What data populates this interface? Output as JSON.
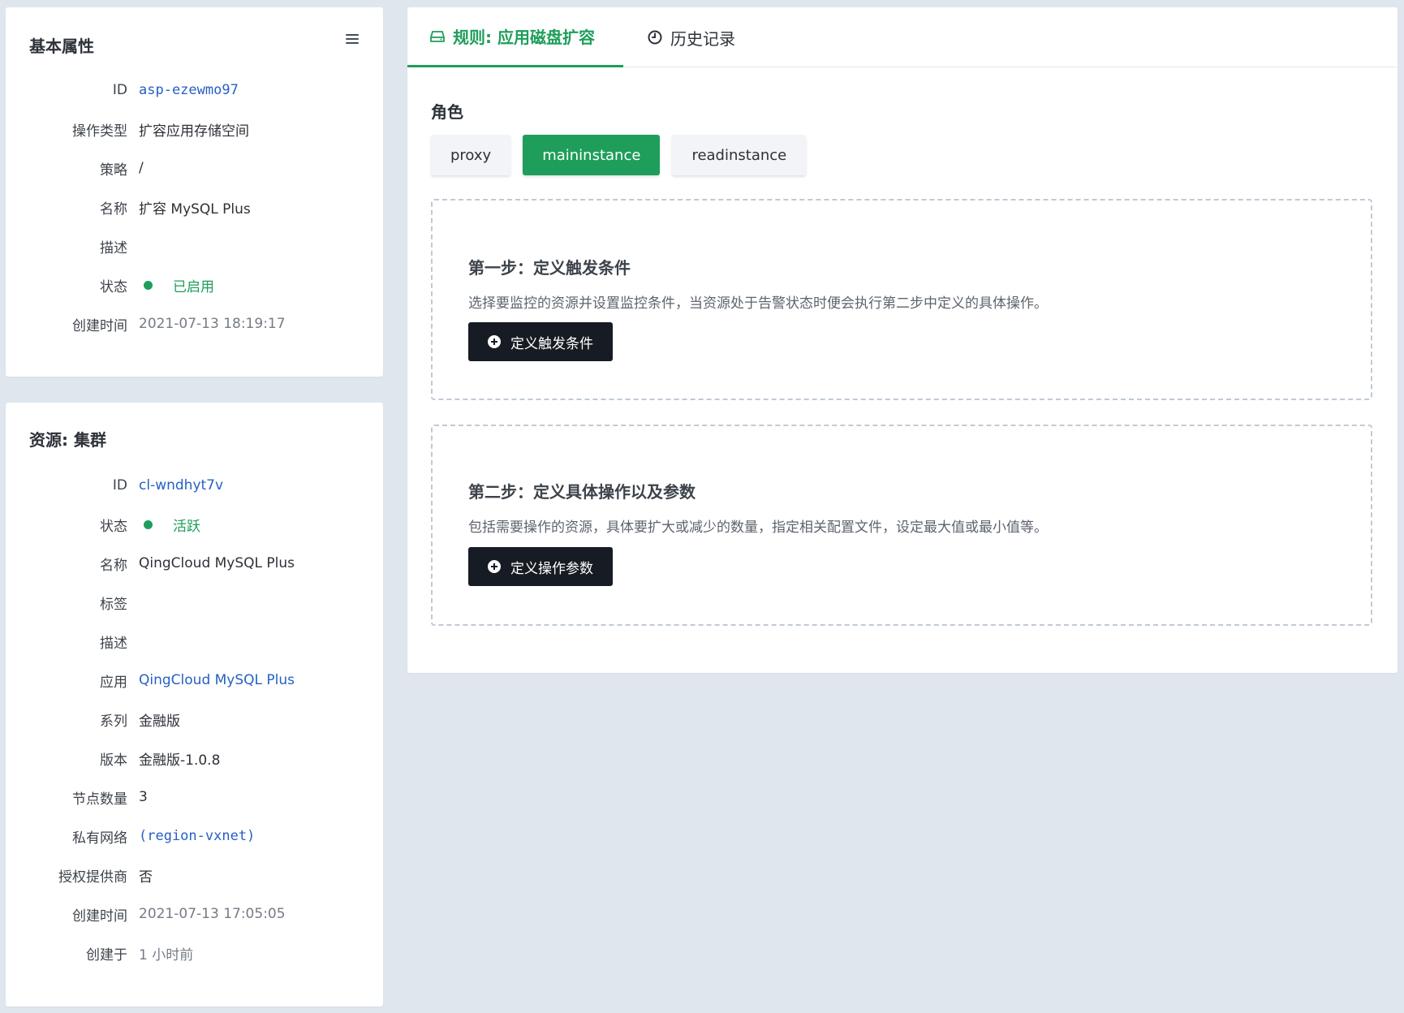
{
  "basic": {
    "title": "基本属性",
    "rows": [
      {
        "label": "ID",
        "value": "asp-ezewmo97"
      },
      {
        "label": "操作类型",
        "value": "扩容应用存储空间"
      },
      {
        "label": "策略",
        "value": "/"
      },
      {
        "label": "名称",
        "value": "扩容 MySQL Plus"
      },
      {
        "label": "描述",
        "value": ""
      },
      {
        "label": "状态",
        "value": "已启用"
      },
      {
        "label": "创建时间",
        "value": "2021-07-13 18:19:17"
      }
    ]
  },
  "resource": {
    "title": "资源: 集群",
    "rows": [
      {
        "label": "ID",
        "value": "cl-wndhyt7v"
      },
      {
        "label": "状态",
        "value": "活跃"
      },
      {
        "label": "名称",
        "value": "QingCloud MySQL Plus"
      },
      {
        "label": "标签",
        "value": ""
      },
      {
        "label": "描述",
        "value": ""
      },
      {
        "label": "应用",
        "value": "QingCloud MySQL Plus"
      },
      {
        "label": "系列",
        "value": "金融版"
      },
      {
        "label": "版本",
        "value": "金融版-1.0.8"
      },
      {
        "label": "节点数量",
        "value": "3"
      },
      {
        "label": "私有网络",
        "value": "(region-vxnet)"
      },
      {
        "label": "授权提供商",
        "value": "否"
      },
      {
        "label": "创建时间",
        "value": "2021-07-13 17:05:05"
      },
      {
        "label": "创建于",
        "value": "1 小时前"
      }
    ]
  },
  "tabs": {
    "rule": "规则: 应用磁盘扩容",
    "history": "历史记录"
  },
  "roles": {
    "label": "角色",
    "items": [
      "proxy",
      "maininstance",
      "readinstance"
    ],
    "selected": "maininstance"
  },
  "steps": [
    {
      "title": "第一步：定义触发条件",
      "desc": "选择要监控的资源并设置监控条件，当资源处于告警状态时便会执行第二步中定义的具体操作。",
      "button": "定义触发条件"
    },
    {
      "title": "第二步：定义具体操作以及参数",
      "desc": "包括需要操作的资源，具体要扩大或减少的数量，指定相关配置文件，设定最大值或最小值等。",
      "button": "定义操作参数"
    }
  ],
  "colors": {
    "accent": "#1e9e5a",
    "link": "#2760c4",
    "dark_button": "#171c24",
    "background": "#dfe6ee"
  }
}
